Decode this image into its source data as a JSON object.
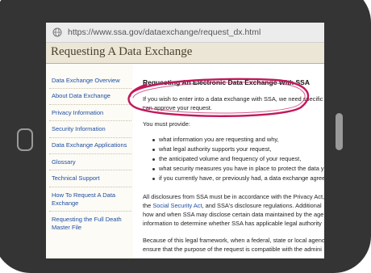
{
  "browser": {
    "url": "https://www.ssa.gov/dataexchange/request_dx.html"
  },
  "header": {
    "title": "Requesting A Data Exchange"
  },
  "sidebar": {
    "items": [
      {
        "label": "Data Exchange Overview"
      },
      {
        "label": "About Data Exchange"
      },
      {
        "label": "Privacy Information"
      },
      {
        "label": "Security Information"
      },
      {
        "label": "Data Exchange Applications"
      },
      {
        "label": "Glossary"
      },
      {
        "label": "Technical Support"
      },
      {
        "label_line1": "How To Request A Data",
        "label_line2": "Exchange"
      },
      {
        "label_line1": "Requesting the Full Death",
        "label_line2": "Master File"
      }
    ]
  },
  "main": {
    "heading": "Requesting An Electronic Data Exchange With SSA",
    "intro_line1": "If you wish to enter into a data exchange with SSA, we need specific",
    "intro_line2": "can approve your request.",
    "must_provide": "You must provide:",
    "bullets": [
      "what information you are requesting and why,",
      "what legal authority supports your request,",
      "the anticipated volume and frequency of your request,",
      "what security measures you have in place to protect the data y",
      "if you currently have, or previously had, a data exchange agree"
    ],
    "para2_line1": "All disclosures from SSA must be in accordance with the Privacy Act,",
    "para2_line2_pre": "the ",
    "para2_line2_link": "Social Security Act",
    "para2_line2_post": ", and SSA's disclosure regulations.  Additional",
    "para2_line3": "how and when SSA may disclose certain data maintained by the age",
    "para2_line4": "information to determine whether SSA has applicable legal authority",
    "para3_line1": "Because of this legal framework, when a federal, state or local agenc",
    "para3_line2": "ensure that the purpose of the request is compatible with the admini"
  },
  "colors": {
    "bezel": "#343434",
    "header_bg": "#ebe6d6",
    "link": "#1f4ea0",
    "annotation": "#c2185b"
  }
}
